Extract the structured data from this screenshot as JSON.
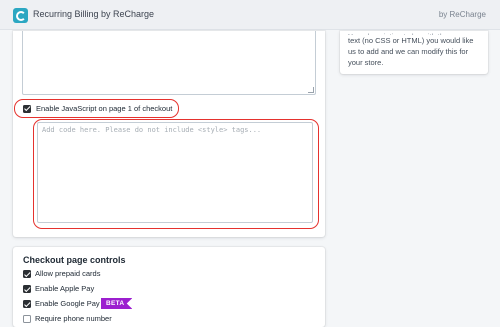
{
  "header": {
    "app_title": "Recurring Billing by ReCharge",
    "vendor": "by ReCharge",
    "logo_icon": "recharge-logo-icon"
  },
  "sidebar_note": {
    "line1": "Your description to be with the",
    "line2": "text (no CSS or HTML) you would like",
    "line3": "us to add and we can modify this for",
    "line4": "your store."
  },
  "code_settings": {
    "enable_js_label": "Enable JavaScript on page 1 of checkout",
    "enable_js_checked": true,
    "code_placeholder": "Add code here. Please do not include <style> tags...",
    "code_value": ""
  },
  "checkout_controls": {
    "title": "Checkout page controls",
    "options": [
      {
        "label": "Allow prepaid cards",
        "checked": true
      },
      {
        "label": "Enable Apple Pay",
        "checked": true
      },
      {
        "label": "Enable Google Pay",
        "checked": true,
        "badge": "BETA"
      },
      {
        "label": "Require phone number",
        "checked": false
      }
    ]
  },
  "colors": {
    "annotation_red": "#e5322e",
    "beta_purple": "#9c1fcf",
    "logo_teal": "#2ba7c2"
  }
}
